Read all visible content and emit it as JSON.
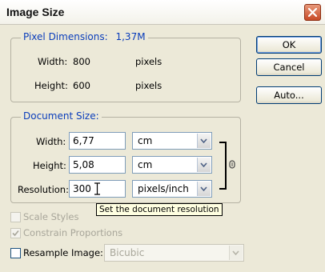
{
  "window": {
    "title": "Image Size"
  },
  "pixel_dimensions": {
    "legend": "Pixel Dimensions:",
    "size": "1,37M",
    "width_label": "Width:",
    "width_value": "800",
    "width_unit": "pixels",
    "height_label": "Height:",
    "height_value": "600",
    "height_unit": "pixels"
  },
  "document_size": {
    "legend": "Document Size:",
    "width_label": "Width:",
    "width_value": "6,77",
    "width_unit": "cm",
    "height_label": "Height:",
    "height_value": "5,08",
    "height_unit": "cm",
    "resolution_label": "Resolution:",
    "resolution_value": "300",
    "resolution_unit": "pixels/inch"
  },
  "tooltip": "Set the document resolution",
  "options": {
    "scale_styles": {
      "label": "Scale Styles",
      "checked": false,
      "enabled": false
    },
    "constrain_proportions": {
      "label": "Constrain Proportions",
      "checked": true,
      "enabled": false
    },
    "resample_image": {
      "label": "Resample Image:",
      "checked": false,
      "enabled": true
    },
    "resample_method": "Bicubic"
  },
  "buttons": {
    "ok": "OK",
    "cancel": "Cancel",
    "auto": "Auto..."
  }
}
